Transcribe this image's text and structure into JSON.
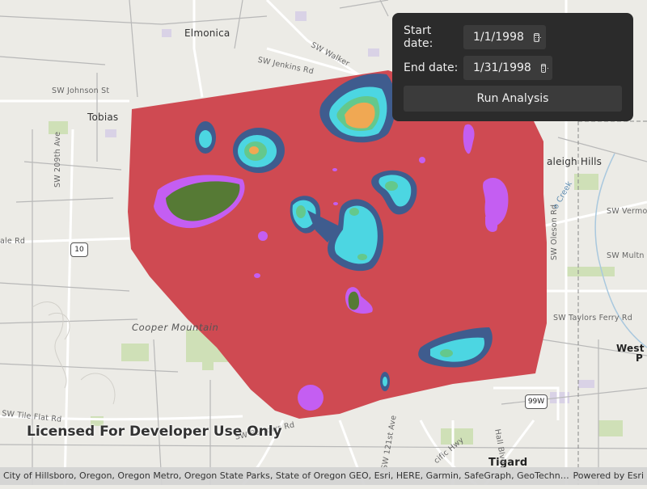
{
  "map": {
    "places": {
      "elmonica": "Elmonica",
      "tobias": "Tobias",
      "raleigh_hills": "aleigh Hills",
      "cooper_mountain": "Cooper Mountain",
      "tigard": "Tigard",
      "west_slope": "West F",
      "west_slope_2": "P"
    },
    "roads": {
      "sw_johnson": "SW Johnson St",
      "sw_jenkins": "SW Jenkins Rd",
      "sw_walker": "SW Walker",
      "sw_209th": "SW 209th Ave",
      "sw_vermont": "SW Vermo",
      "sw_multnomah": "SW Multn",
      "sw_oleson": "SW Oleson Rd",
      "sw_taylors_ferry": "SW Taylors Ferry Rd",
      "sw_tile_flat": "SW Tile Flat Rd",
      "sw_barrows": "SW Barrows Rd",
      "sw_121st": "SW 121st Ave",
      "pacific_hwy": "cific Hwy",
      "hall_blvd": "Hall Blvd",
      "farmington": "ale Rd",
      "fanno_creek": "o Creek"
    },
    "shields": {
      "or10": "10",
      "us99w": "99W"
    }
  },
  "panel": {
    "start_label": "Start date:",
    "start_value": "1/1/1998",
    "end_label": "End date:",
    "end_value": "1/31/1998",
    "run_label": "Run Analysis"
  },
  "watermark": "Licensed For Developer Use Only",
  "attribution": {
    "sources": "City of Hillsboro, Oregon, Oregon Metro, Oregon State Parks, State of Oregon GEO, Esri, HERE, Garmin, SafeGraph, GeoTechnologies, Inc, METI/NASA, USGS, EPA, NPS, USDA",
    "powered_by": "Powered by Esri"
  },
  "colors": {
    "base": "#cf4a52",
    "dark_blue": "#3f5c8e",
    "cyan": "#4cd6e2",
    "green": "#64c88c",
    "orange": "#f0a853",
    "magenta": "#c45ef2",
    "olive": "#567a35",
    "panel_bg": "#2b2b2b"
  }
}
